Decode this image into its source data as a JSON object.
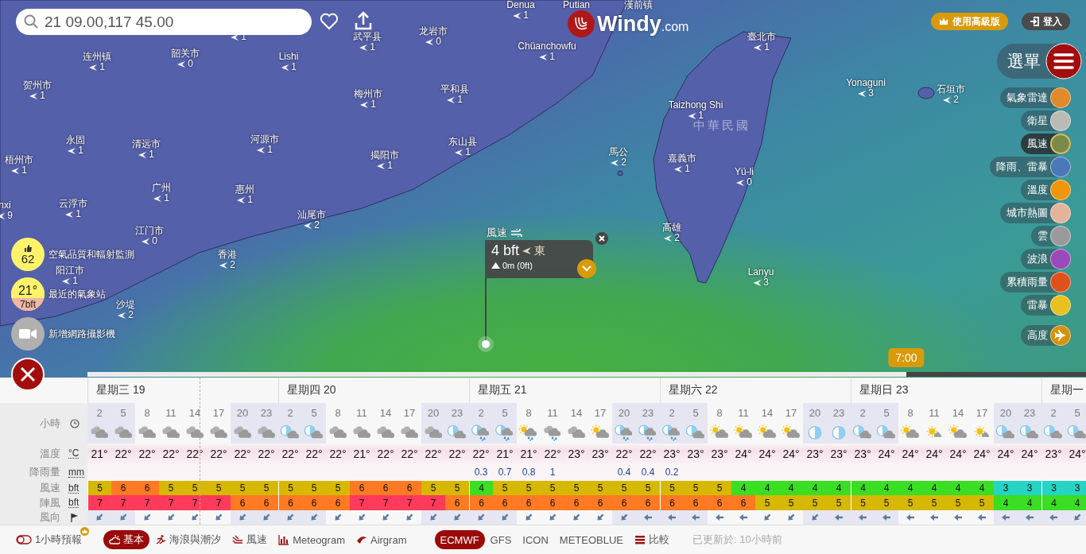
{
  "search": {
    "value": "21 09.00,117 45.00"
  },
  "logo": {
    "name": "Windy",
    "domain": ".com"
  },
  "header_buttons": [
    {
      "label": "使用高級版",
      "kind": "premium"
    },
    {
      "label": "登入",
      "kind": "login"
    }
  ],
  "menu": {
    "label": "選單"
  },
  "cities": [
    {
      "value": "1"
    },
    {
      "name": "Denua",
      "value": "1"
    },
    {
      "name": "Putian"
    },
    {
      "name": "漢前镇"
    },
    {
      "name": "武平县",
      "value": "1"
    },
    {
      "name": "龙岩市",
      "value": "0"
    },
    {
      "name": "Chüanchowfu",
      "value": "1"
    },
    {
      "name": "臺北市",
      "value": "1"
    },
    {
      "name": "连州镇",
      "value": "1"
    },
    {
      "name": "韶关市",
      "value": "0"
    },
    {
      "name": "Lishi",
      "value": "1"
    },
    {
      "name": "贺州市",
      "value": "1"
    },
    {
      "name": "梅州市",
      "value": "1"
    },
    {
      "name": "平和县",
      "value": "1"
    },
    {
      "name": "Yonaguni",
      "value": "3"
    },
    {
      "name": "石垣市",
      "value": "2"
    },
    {
      "name": "Taizhong Shi",
      "value": "1"
    },
    {
      "name": "永固",
      "value": "1"
    },
    {
      "name": "清远市",
      "value": "1"
    },
    {
      "name": "河源市",
      "value": "1"
    },
    {
      "name": "揭阳市",
      "value": "1"
    },
    {
      "name": "东山县",
      "value": "1"
    },
    {
      "name": "馬公",
      "value": "2"
    },
    {
      "name": "嘉義市",
      "value": "1"
    },
    {
      "name": "Yü-li",
      "value": "0"
    },
    {
      "name": "梧州市",
      "value": "1"
    },
    {
      "name": "广州",
      "value": "1"
    },
    {
      "name": "惠州",
      "value": "1"
    },
    {
      "name": "云浮市",
      "value": "1"
    },
    {
      "name": "nxi",
      "value": "9"
    },
    {
      "name": "汕尾市",
      "value": "2"
    },
    {
      "name": "江门市",
      "value": "0"
    },
    {
      "name": "高雄",
      "value": "2"
    },
    {
      "name": "香港",
      "value": "2"
    },
    {
      "name": "Lanyu",
      "value": "3"
    },
    {
      "name": "阳江市",
      "value": "1"
    },
    {
      "name": "沙堤",
      "value": "2"
    }
  ],
  "country_label": "中華民國",
  "layers": [
    {
      "label": "氣象雷達",
      "selected": false,
      "color": "#e08a2a",
      "kind": "map"
    },
    {
      "label": "衛星",
      "selected": false,
      "color": "#b8bcb4",
      "kind": "map"
    },
    {
      "label": "風速",
      "selected": true,
      "color": "#7a8a4a",
      "kind": "map"
    },
    {
      "label": "降雨、雷暴",
      "selected": false,
      "color": "#4a78b8",
      "kind": "map"
    },
    {
      "label": "溫度",
      "selected": false,
      "color": "#f0960a",
      "kind": "map"
    },
    {
      "label": "城市熱圖",
      "selected": false,
      "color": "#e4b49a",
      "kind": "map"
    },
    {
      "label": "雲",
      "selected": false,
      "color": "#9a9a9a",
      "kind": "map"
    },
    {
      "label": "波浪",
      "selected": false,
      "color": "#9a4ab8",
      "kind": "map"
    },
    {
      "label": "累積雨量",
      "selected": false,
      "color": "#e0501a",
      "kind": "map"
    },
    {
      "label": "雷暴",
      "selected": false,
      "color": "#e8c020",
      "kind": "map"
    },
    {
      "label": "高度",
      "selected": false,
      "color": "#d4930a",
      "kind": "plane"
    }
  ],
  "left_controls": [
    {
      "kind": "air",
      "value": "62",
      "label": "空氣品質和輻射監測"
    },
    {
      "kind": "station",
      "value": "21°",
      "sub": "7bft",
      "label": "最近的氣象站"
    },
    {
      "kind": "webcam",
      "label": "新增網路攝影機"
    }
  ],
  "popup": {
    "title": "風速",
    "value": "4 bft",
    "direction": "東",
    "elevation": "0m (0ft)"
  },
  "timeline": {
    "time": "7:00",
    "level": 0.82
  },
  "forecast": {
    "days": [
      {
        "label": "星期三 19"
      },
      {
        "label": "星期四 20"
      },
      {
        "label": "星期五 21"
      },
      {
        "label": "星期六 22"
      },
      {
        "label": "星期日 23"
      },
      {
        "label": "星期一"
      }
    ],
    "row_labels": [
      {
        "label": "小時",
        "kind": "hour"
      },
      {
        "label": "溫度",
        "unit": "°C",
        "kind": "temp"
      },
      {
        "label": "降雨量",
        "unit": "mm",
        "kind": "rain"
      },
      {
        "label": "風速",
        "unit": "bft",
        "kind": "wind"
      },
      {
        "label": "陣風",
        "unit": "bft",
        "kind": "gust"
      },
      {
        "label": "風向",
        "kind": "dir"
      }
    ],
    "weather_icons": [
      {
        "kind": "cloudy"
      },
      {
        "kind": "cloudy"
      },
      {
        "kind": "cloudy"
      },
      {
        "kind": "cloudy"
      },
      {
        "kind": "cloudy"
      },
      {
        "kind": "cloudy"
      },
      {
        "kind": "cloudy"
      },
      {
        "kind": "cloudy"
      },
      {
        "kind": "moon-cloud"
      },
      {
        "kind": "moon-cloud"
      },
      {
        "kind": "cloudy"
      },
      {
        "kind": "cloudy"
      },
      {
        "kind": "cloudy"
      },
      {
        "kind": "cloudy"
      },
      {
        "kind": "cloudy"
      },
      {
        "kind": "moon-cloud"
      },
      {
        "kind": "moon-rain"
      },
      {
        "kind": "moon-rain"
      },
      {
        "kind": "sun-rain"
      },
      {
        "kind": "cloud-rain"
      },
      {
        "kind": "cloudy"
      },
      {
        "kind": "sun-cloud"
      },
      {
        "kind": "moon-rain"
      },
      {
        "kind": "moon-rain"
      },
      {
        "kind": "moon-rain"
      },
      {
        "kind": "moon-cloud"
      },
      {
        "kind": "sun-cloud"
      },
      {
        "kind": "sun-cloud"
      },
      {
        "kind": "sun-cloud"
      },
      {
        "kind": "sun-cloud"
      },
      {
        "kind": "moon"
      },
      {
        "kind": "moon"
      },
      {
        "kind": "moon-cloud"
      },
      {
        "kind": "moon-cloud"
      },
      {
        "kind": "sun-cloud"
      },
      {
        "kind": "sun"
      },
      {
        "kind": "sun-cloud"
      },
      {
        "kind": "sun"
      },
      {
        "kind": "moon-cloud"
      },
      {
        "kind": "moon-cloud"
      },
      {
        "kind": "moon-cloud"
      },
      {
        "kind": "moon-cloud"
      }
    ],
    "wind_directions": [
      {
        "kind": "sw"
      },
      {
        "kind": "sw"
      },
      {
        "kind": "sw"
      },
      {
        "kind": "sw"
      },
      {
        "kind": "sw"
      },
      {
        "kind": "sw"
      },
      {
        "kind": "sw"
      },
      {
        "kind": "sw"
      },
      {
        "kind": "sw"
      },
      {
        "kind": "sw"
      },
      {
        "kind": "sw"
      },
      {
        "kind": "sw"
      },
      {
        "kind": "sw"
      },
      {
        "kind": "sw"
      },
      {
        "kind": "sw"
      },
      {
        "kind": "sw"
      },
      {
        "kind": "sw"
      },
      {
        "kind": "sw"
      },
      {
        "kind": "sw"
      },
      {
        "kind": "sw"
      },
      {
        "kind": "sw"
      },
      {
        "kind": "sw"
      },
      {
        "kind": "sw"
      },
      {
        "kind": "w"
      },
      {
        "kind": "w"
      },
      {
        "kind": "w"
      },
      {
        "kind": "w"
      },
      {
        "kind": "w"
      },
      {
        "kind": "sw"
      },
      {
        "kind": "sw"
      },
      {
        "kind": "sw"
      },
      {
        "kind": "w"
      },
      {
        "kind": "w"
      },
      {
        "kind": "w"
      },
      {
        "kind": "w"
      },
      {
        "kind": "w"
      },
      {
        "kind": "w"
      },
      {
        "kind": "w"
      },
      {
        "kind": "w"
      },
      {
        "kind": "w"
      },
      {
        "kind": "w"
      },
      {
        "kind": "sw"
      }
    ],
    "columns": [
      {
        "hour": "2",
        "temp": "21°",
        "wind": "5",
        "gust": "7",
        "night": true
      },
      {
        "hour": "5",
        "temp": "22°",
        "wind": "6",
        "gust": "7",
        "night": true
      },
      {
        "hour": "8",
        "temp": "22°",
        "wind": "6",
        "gust": "7",
        "night": false
      },
      {
        "hour": "11",
        "temp": "22°",
        "wind": "5",
        "gust": "7",
        "night": false
      },
      {
        "hour": "14",
        "temp": "22°",
        "wind": "5",
        "gust": "7",
        "night": false
      },
      {
        "hour": "17",
        "temp": "22°",
        "wind": "5",
        "gust": "7",
        "night": false
      },
      {
        "hour": "20",
        "temp": "22°",
        "wind": "5",
        "gust": "6",
        "night": true
      },
      {
        "hour": "23",
        "temp": "22°",
        "wind": "5",
        "gust": "6",
        "night": true
      },
      {
        "hour": "2",
        "temp": "22°",
        "wind": "5",
        "gust": "6",
        "night": true
      },
      {
        "hour": "5",
        "temp": "22°",
        "wind": "5",
        "gust": "6",
        "night": true
      },
      {
        "hour": "8",
        "temp": "22°",
        "wind": "5",
        "gust": "6",
        "night": false
      },
      {
        "hour": "11",
        "temp": "21°",
        "wind": "6",
        "gust": "7",
        "night": false
      },
      {
        "hour": "14",
        "temp": "22°",
        "wind": "6",
        "gust": "7",
        "night": false
      },
      {
        "hour": "17",
        "temp": "22°",
        "wind": "6",
        "gust": "7",
        "night": false
      },
      {
        "hour": "20",
        "temp": "22°",
        "wind": "5",
        "gust": "7",
        "night": true
      },
      {
        "hour": "23",
        "temp": "22°",
        "wind": "5",
        "gust": "6",
        "night": true
      },
      {
        "hour": "2",
        "temp": "22°",
        "rain": "0.3",
        "wind": "4",
        "gust": "6",
        "night": true
      },
      {
        "hour": "5",
        "temp": "21°",
        "rain": "0.7",
        "wind": "5",
        "gust": "6",
        "night": true
      },
      {
        "hour": "8",
        "temp": "21°",
        "rain": "0.8",
        "wind": "5",
        "gust": "6",
        "night": false
      },
      {
        "hour": "11",
        "temp": "22°",
        "rain": "1",
        "wind": "5",
        "gust": "6",
        "night": false
      },
      {
        "hour": "14",
        "temp": "23°",
        "wind": "5",
        "gust": "6",
        "night": false
      },
      {
        "hour": "17",
        "temp": "23°",
        "wind": "5",
        "gust": "6",
        "night": false
      },
      {
        "hour": "20",
        "temp": "22°",
        "rain": "0.4",
        "wind": "5",
        "gust": "6",
        "night": true
      },
      {
        "hour": "23",
        "temp": "22°",
        "rain": "0.4",
        "wind": "5",
        "gust": "6",
        "night": true
      },
      {
        "hour": "2",
        "temp": "23°",
        "rain": "0.2",
        "wind": "5",
        "gust": "6",
        "night": true
      },
      {
        "hour": "5",
        "temp": "23°",
        "wind": "5",
        "gust": "6",
        "night": true
      },
      {
        "hour": "8",
        "temp": "23°",
        "wind": "5",
        "gust": "6",
        "night": false
      },
      {
        "hour": "11",
        "temp": "24°",
        "wind": "4",
        "gust": "6",
        "night": false
      },
      {
        "hour": "14",
        "temp": "24°",
        "wind": "4",
        "gust": "5",
        "night": false
      },
      {
        "hour": "17",
        "temp": "24°",
        "wind": "4",
        "gust": "5",
        "night": false
      },
      {
        "hour": "20",
        "temp": "23°",
        "wind": "4",
        "gust": "5",
        "night": true
      },
      {
        "hour": "23",
        "temp": "23°",
        "wind": "4",
        "gust": "5",
        "night": true
      },
      {
        "hour": "2",
        "temp": "23°",
        "wind": "4",
        "gust": "5",
        "night": true
      },
      {
        "hour": "5",
        "temp": "24°",
        "wind": "4",
        "gust": "5",
        "night": true
      },
      {
        "hour": "8",
        "temp": "24°",
        "wind": "4",
        "gust": "5",
        "night": false
      },
      {
        "hour": "11",
        "temp": "24°",
        "wind": "4",
        "gust": "5",
        "night": false
      },
      {
        "hour": "14",
        "temp": "24°",
        "wind": "4",
        "gust": "5",
        "night": false
      },
      {
        "hour": "17",
        "temp": "24°",
        "wind": "4",
        "gust": "5",
        "night": false
      },
      {
        "hour": "20",
        "temp": "24°",
        "wind": "3",
        "gust": "4",
        "night": true
      },
      {
        "hour": "23",
        "temp": "24°",
        "wind": "3",
        "gust": "4",
        "night": true
      },
      {
        "hour": "2",
        "temp": "23°",
        "wind": "3",
        "gust": "4",
        "night": true
      },
      {
        "hour": "5",
        "temp": "24°",
        "wind": "3",
        "gust": "4",
        "night": true
      }
    ]
  },
  "footer": {
    "hourly_toggle": {
      "label": "1小時預報",
      "on": false
    },
    "views": [
      {
        "label": "基本",
        "kind": "basic",
        "selected": true
      },
      {
        "label": "海浪與潮汐",
        "kind": "waves",
        "selected": false
      },
      {
        "label": "風速",
        "kind": "wind",
        "selected": false
      },
      {
        "label": "Meteogram",
        "kind": "meteogram",
        "selected": false
      },
      {
        "label": "Airgram",
        "kind": "airgram",
        "selected": false
      }
    ],
    "models": [
      {
        "label": "ECMWF",
        "kind": "model",
        "selected": true
      },
      {
        "label": "GFS",
        "kind": "model",
        "selected": false
      },
      {
        "label": "ICON",
        "kind": "model",
        "selected": false
      },
      {
        "label": "METEOBLUE",
        "kind": "model",
        "selected": false
      },
      {
        "label": "比較",
        "kind": "compare",
        "selected": false
      }
    ],
    "updated": "已更新於: 10小時前"
  }
}
